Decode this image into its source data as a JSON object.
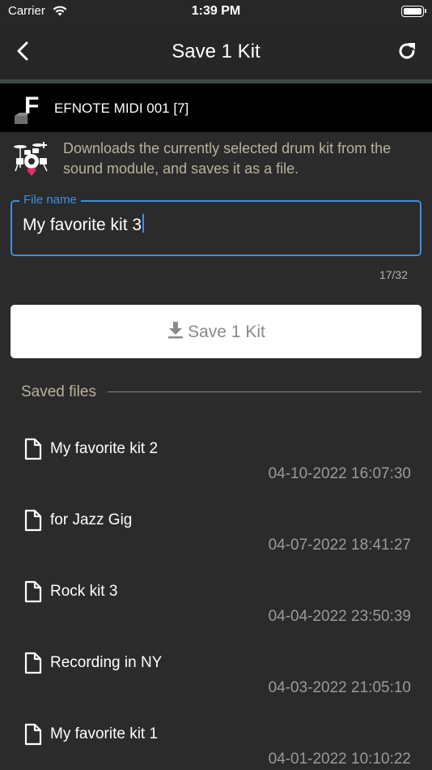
{
  "status_bar": {
    "carrier": "Carrier",
    "time": "1:39 PM"
  },
  "nav": {
    "title": "Save 1 Kit",
    "back_icon": "chevron-left-icon",
    "refresh_icon": "refresh-icon"
  },
  "device": {
    "name": "EFNOTE MIDI 001 [7]",
    "logo_letter": "F"
  },
  "description": "Downloads the currently selected drum kit from the sound module, and saves it as a file.",
  "file_name_field": {
    "label": "File name",
    "value": "My favorite kit 3",
    "char_count": "17/32"
  },
  "save_button": {
    "label": "Save 1 Kit",
    "icon": "download-icon"
  },
  "saved_files": {
    "header": "Saved files",
    "items": [
      {
        "name": "My favorite kit 2",
        "date": "04-10-2022 16:07:30"
      },
      {
        "name": "for Jazz Gig",
        "date": "04-07-2022 18:41:27"
      },
      {
        "name": "Rock kit 3",
        "date": "04-04-2022 23:50:39"
      },
      {
        "name": "Recording in NY",
        "date": "04-03-2022 21:05:10"
      },
      {
        "name": "My favorite kit 1",
        "date": "04-01-2022 10:10:22"
      }
    ]
  },
  "colors": {
    "accent": "#3e8fe0",
    "background": "#2b2b2b",
    "description_text": "#b9b29b",
    "drum_icon_heart": "#e0306a"
  }
}
